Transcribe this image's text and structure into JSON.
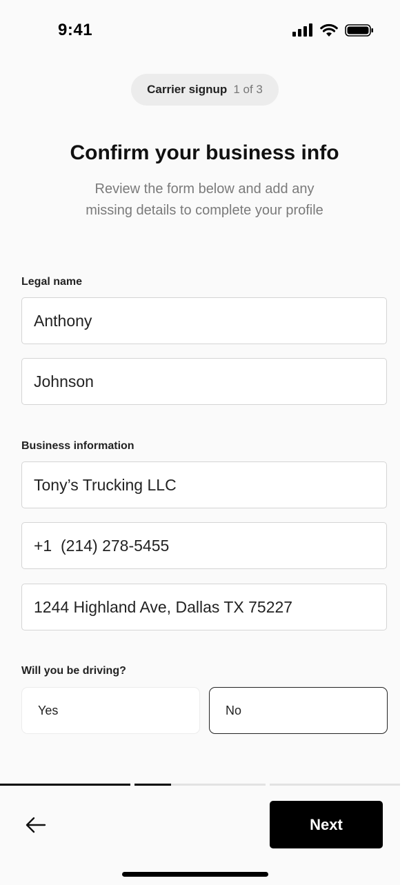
{
  "status_bar": {
    "time": "9:41",
    "icons": [
      "signal-icon",
      "wifi-icon",
      "battery-icon"
    ]
  },
  "header": {
    "step_title": "Carrier signup",
    "step_count": "1 of 3",
    "title": "Confirm your business info",
    "subtitle": "Review the form below and add any missing details to complete your profile"
  },
  "legal_name": {
    "label": "Legal name",
    "first_name": "Anthony",
    "last_name": "Johnson"
  },
  "business": {
    "label": "Business information",
    "company_name": "Tony’s Trucking LLC",
    "phone": "+1  (214) 278-5455",
    "address": "1244 Highland Ave, Dallas TX 75227"
  },
  "driving": {
    "label": "Will you be driving?",
    "options": [
      "Yes",
      "No"
    ],
    "selected": "No"
  },
  "progress": {
    "completed_steps": 1,
    "total_steps": 3,
    "current_step_progress": 0.28
  },
  "footer": {
    "back_icon": "arrow-left-icon",
    "next_label": "Next"
  },
  "colors": {
    "accent": "#000000",
    "background": "#fafafa",
    "muted_text": "#7a7a7a",
    "border": "#d4d4d4",
    "track": "#e2e2e2"
  }
}
